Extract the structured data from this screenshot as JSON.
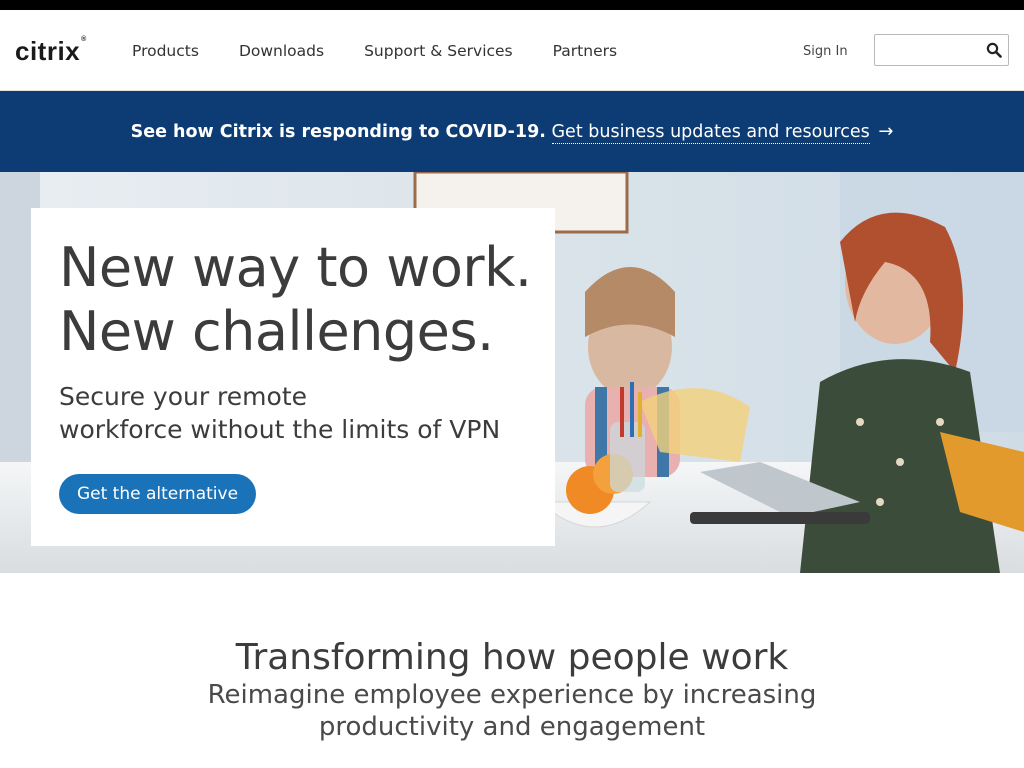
{
  "brand": {
    "logo_text": "citrix",
    "registered_mark": "®"
  },
  "header": {
    "nav": [
      {
        "label": "Products"
      },
      {
        "label": "Downloads"
      },
      {
        "label": "Support & Services"
      },
      {
        "label": "Partners"
      }
    ],
    "sign_in_label": "Sign In",
    "search": {
      "placeholder": "",
      "value": "",
      "icon": "search-icon"
    }
  },
  "banner": {
    "text": "See how Citrix is responding to COVID-19.",
    "link_label": "Get business updates and resources",
    "arrow": "→",
    "background": "#0d3c74"
  },
  "hero": {
    "title_line1": "New way to work.",
    "title_line2": "New challenges.",
    "subtitle_line1": "Secure your remote",
    "subtitle_line2": "workforce without the limits of VPN",
    "cta_label": "Get the alternative",
    "cta_color": "#1a73b8"
  },
  "section": {
    "title": "Transforming how people work",
    "subtitle": "Reimagine employee experience by increasing productivity and engagement"
  }
}
